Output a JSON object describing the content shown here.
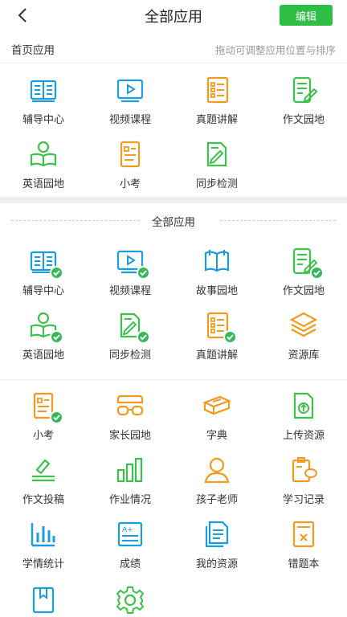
{
  "header": {
    "title": "全部应用",
    "edit_label": "编辑"
  },
  "home_section": {
    "title": "首页应用",
    "hint": "拖动可调整应用位置与排序"
  },
  "home_apps": [
    {
      "label": "辅导中心",
      "icon": "book-open-icon"
    },
    {
      "label": "视频课程",
      "icon": "video-play-icon"
    },
    {
      "label": "真题讲解",
      "icon": "checklist-icon"
    },
    {
      "label": "作文园地",
      "icon": "notebook-pen-icon"
    },
    {
      "label": "英语园地",
      "icon": "reader-icon"
    },
    {
      "label": "小考",
      "icon": "quiz-doc-icon"
    },
    {
      "label": "同步检测",
      "icon": "doc-edit-icon"
    }
  ],
  "all_section": {
    "title": "全部应用"
  },
  "all_apps": [
    {
      "label": "辅导中心",
      "icon": "book-open-icon",
      "added": true
    },
    {
      "label": "视频课程",
      "icon": "video-play-icon",
      "added": true
    },
    {
      "label": "故事园地",
      "icon": "storybook-icon",
      "added": false
    },
    {
      "label": "作文园地",
      "icon": "notebook-pen-icon",
      "added": true
    },
    {
      "label": "英语园地",
      "icon": "reader-icon",
      "added": true
    },
    {
      "label": "同步检测",
      "icon": "doc-edit-icon",
      "added": true
    },
    {
      "label": "真题讲解",
      "icon": "checklist-icon",
      "added": true
    },
    {
      "label": "资源库",
      "icon": "layers-icon",
      "added": false
    },
    {
      "label": "小考",
      "icon": "quiz-doc-icon",
      "added": true
    },
    {
      "label": "家长园地",
      "icon": "glasses-icon",
      "added": false
    },
    {
      "label": "字典",
      "icon": "dictionary-icon",
      "added": false
    },
    {
      "label": "上传资源",
      "icon": "upload-doc-icon",
      "added": false
    },
    {
      "label": "作文投稿",
      "icon": "submit-doc-icon",
      "added": false
    },
    {
      "label": "作业情况",
      "icon": "bar-chart-icon",
      "added": false
    },
    {
      "label": "孩子老师",
      "icon": "person-icon",
      "added": false
    },
    {
      "label": "学习记录",
      "icon": "clipboard-chat-icon",
      "added": false
    },
    {
      "label": "学情统计",
      "icon": "stats-chart-icon",
      "added": false
    },
    {
      "label": "成绩",
      "icon": "score-sheet-icon",
      "added": false
    },
    {
      "label": "我的资源",
      "icon": "my-files-icon",
      "added": false
    },
    {
      "label": "错题本",
      "icon": "mistake-book-icon",
      "added": false
    },
    {
      "label": "",
      "icon": "bookmark-book-icon",
      "added": false
    },
    {
      "label": "",
      "icon": "gear-icon",
      "added": false
    }
  ],
  "colors": {
    "blue": "#1b9be0",
    "orange": "#f29a1f",
    "green": "#3cc24a",
    "edit_button": "#2ebd45",
    "badge": "#34b85a"
  }
}
